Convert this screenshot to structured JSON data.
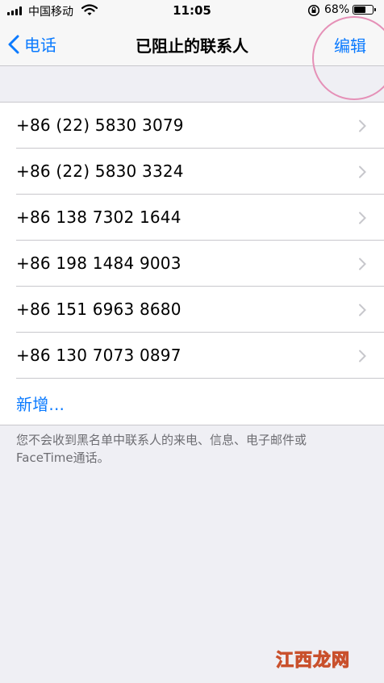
{
  "status": {
    "carrier": "中国移动",
    "time": "11:05",
    "battery_percent": "68%",
    "battery_level": 0.68
  },
  "nav": {
    "back_label": "电话",
    "title": "已阻止的联系人",
    "edit_label": "编辑",
    "highlight_color": "#e590b7"
  },
  "blocked": [
    {
      "number": "+86 (22) 5830 3079"
    },
    {
      "number": "+86 (22) 5830 3324"
    },
    {
      "number": "+86 138 7302 1644"
    },
    {
      "number": "+86 198 1484 9003"
    },
    {
      "number": "+86 151 6963 8680"
    },
    {
      "number": "+86 130 7073 0897"
    }
  ],
  "add_label": "新增...",
  "footer_note": "您不会收到黑名单中联系人的来电、信息、电子邮件或FaceTime通话。",
  "watermark": "江西龙网",
  "colors": {
    "accent": "#0a7aff",
    "background": "#efeff4",
    "separator": "#c8c7cc"
  }
}
